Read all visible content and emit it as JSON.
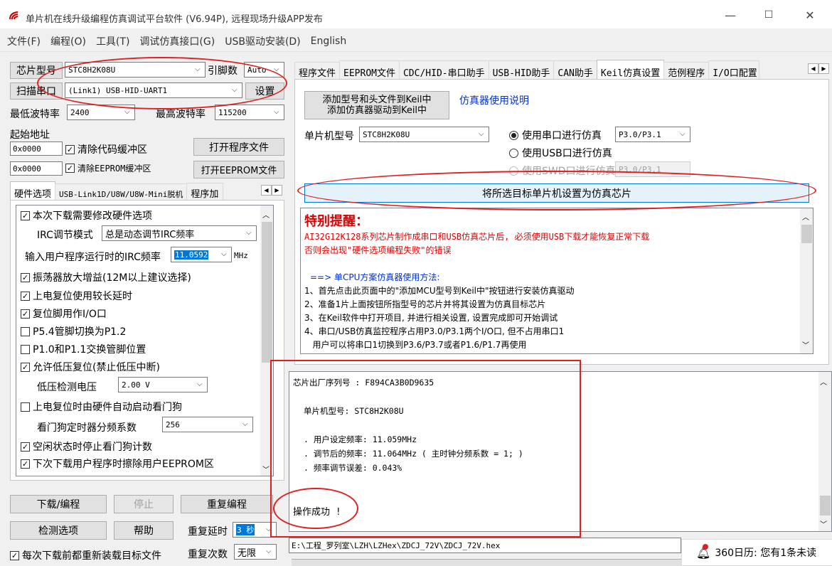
{
  "window": {
    "title": "单片机在线升级编程仿真调试平台软件 (V6.94P), 远程现场升级APP发布",
    "minimize": "—",
    "maximize": "☐",
    "close": "✕"
  },
  "menu": [
    "文件(F)",
    "编程(O)",
    "工具(T)",
    "调试仿真接口(G)",
    "USB驱动安装(D)",
    "English"
  ],
  "left": {
    "chip_btn": "芯片型号",
    "chip_value": "STC8H2K08U",
    "pin_label": "引脚数",
    "pin_value": "Auto",
    "scan_btn": "扫描串口",
    "port_value": "(Link1) USB-HID-UART1",
    "settings_btn": "设置",
    "min_baud_label": "最低波特率",
    "min_baud_value": "2400",
    "max_baud_label": "最高波特率",
    "max_baud_value": "115200",
    "start_addr_label": "起始地址",
    "addr1": "0x0000",
    "clear_code": "清除代码缓冲区",
    "open_prog": "打开程序文件",
    "addr2": "0x0000",
    "clear_eeprom": "清除EEPROM缓冲区",
    "open_eeprom": "打开EEPROM文件",
    "tabs": [
      "硬件选项",
      "USB-Link1D/U8W/U8W-Mini脱机",
      "程序加"
    ],
    "options": {
      "opt1": "本次下载需要修改硬件选项",
      "irc_mode_label": "IRC调节模式",
      "irc_mode_value": "总是动态调节IRC频率",
      "irc_freq_label": "输入用户程序运行时的IRC频率",
      "irc_freq_value": "11.0592",
      "irc_unit": "MHz",
      "opt2": "振荡器放大增益(12M以上建议选择)",
      "opt3": "上电复位使用较长延时",
      "opt4": "复位脚用作I/O口",
      "opt5": "P5.4管脚切换为P1.2",
      "opt6": "P1.0和P1.1交换管脚位置",
      "opt7": "允许低压复位(禁止低压中断)",
      "lvd_label": "低压检测电压",
      "lvd_value": "2.00 V",
      "opt8": "上电复位时由硬件自动启动看门狗",
      "wdt_label": "看门狗定时器分频系数",
      "wdt_value": "256",
      "opt9": "空闲状态时停止看门狗计数",
      "opt10": "下次下载用户程序时擦除用户EEPROM区"
    },
    "download_btn": "下载/编程",
    "stop_btn": "停止",
    "repeat_btn": "重复编程",
    "detect_btn": "检测选项",
    "help_btn": "帮助",
    "repeat_delay_label": "重复延时",
    "repeat_delay_value": "3 秒",
    "reload_label": "每次下载前都重新装载目标文件",
    "repeat_count_label": "重复次数",
    "repeat_count_value": "无限"
  },
  "right": {
    "tabs": [
      "程序文件",
      "EEPROM文件",
      "CDC/HID-串口助手",
      "USB-HID助手",
      "CAN助手",
      "Keil仿真设置",
      "范例程序",
      "I/O口配置"
    ],
    "add_keil_btn_line1": "添加型号和头文件到Keil中",
    "add_keil_btn_line2": "添加仿真器驱动到Keil中",
    "emu_help_link": "仿真器使用说明",
    "mcu_label": "单片机型号",
    "mcu_value": "STC8H2K08U",
    "radio1": "使用串口进行仿真",
    "radio1_port": "P3.0/P3.1",
    "radio2": "使用USB口进行仿真",
    "radio3": "使用SWD口进行仿真",
    "radio3_port": "P3.0/P3.1",
    "set_target_btn": "将所选目标单片机设置为仿真芯片",
    "notice_title": "特别提醒：",
    "notice_line1": "AI32G12K128系列芯片制作成串口和USB仿真芯片后, 必须使用USB下载才能恢复正常下载",
    "notice_line2": "否则会出现\"硬件选项编程失败\"的错误",
    "usage_title": "==> 单CPU方案仿真器使用方法:",
    "usage_lines": [
      "1、首先点击此页面中的\"添加MCU型号到Keil中\"按钮进行安装仿真驱动",
      "2、准备1片上面按钮所指型号的芯片并将其设置为仿真目标芯片",
      "3、在Keil软件中打开项目, 并进行相关设置, 设置完成即可开始调试",
      "4、串口/USB仿真监控程序占用P3.0/P3.1两个I/O口, 但不占用串口1",
      "   用户可以将串口1切换到P3.6/P3.7或者P1.6/P1.7再使用"
    ]
  },
  "output": {
    "serial": "芯片出厂序列号 : F894CA3B0D9635",
    "mcu": "单片机型号: STC8H2K08U",
    "user_freq": ". 用户设定频率: 11.059MHz",
    "adj_freq": ". 调节后的频率: 11.064MHz ( 主时钟分频系数 = 1; )",
    "freq_err": ". 频率调节误差: 0.043%",
    "success": "操作成功 !"
  },
  "footer": {
    "path": "E:\\工程_罗列室\\LZH\\LZHex\\ZDCJ_72V\\ZDCJ_72V.hex",
    "notification": "360日历: 您有1条未读",
    "notification_count": "1"
  }
}
